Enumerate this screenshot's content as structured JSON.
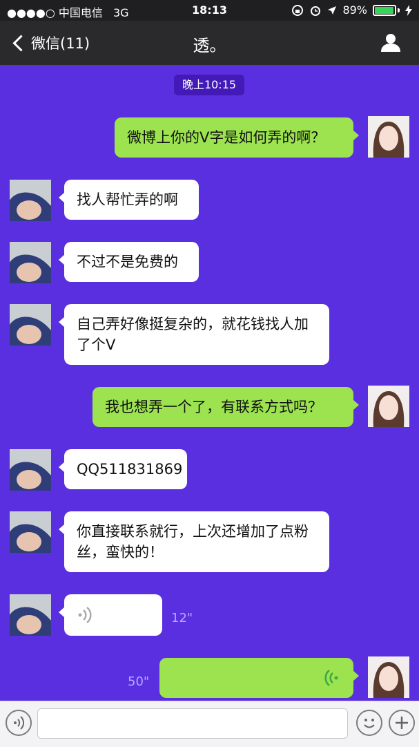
{
  "status_bar": {
    "carrier": "●●●●○ 中国电信",
    "network": "3G",
    "time": "18:13",
    "battery_percent": "89%",
    "battery_level": 0.89
  },
  "nav": {
    "back_label": "微信(11)",
    "title": "透。"
  },
  "chat": {
    "timestamp": "晚上10:15",
    "messages": [
      {
        "sender": "me",
        "text": "微博上你的V字是如何弄的啊？"
      },
      {
        "sender": "other",
        "text": "找人帮忙弄的啊"
      },
      {
        "sender": "other",
        "text": "不过不是免费的"
      },
      {
        "sender": "other",
        "text": "自己弄好像挺复杂的，就花钱找人加了个V"
      },
      {
        "sender": "me",
        "text": "我也想弄一个了，有联系方式吗？"
      },
      {
        "sender": "other",
        "text": "QQ511831869"
      },
      {
        "sender": "other",
        "text": "你直接联系就行，上次还增加了点粉丝，蛮快的！"
      },
      {
        "sender": "other",
        "type": "voice",
        "duration": "12\""
      },
      {
        "sender": "me",
        "type": "voice",
        "duration": "50\""
      }
    ]
  },
  "colors": {
    "chat_background": "#5a2fe0",
    "my_bubble": "#9ce34f",
    "their_bubble": "#ffffff",
    "nav_background": "#2a2a2d"
  },
  "icons": {
    "back": "chevron-left-icon",
    "profile": "person-icon",
    "voice_toggle": "voice-icon",
    "emoji": "emoji-icon",
    "more": "plus-icon"
  }
}
